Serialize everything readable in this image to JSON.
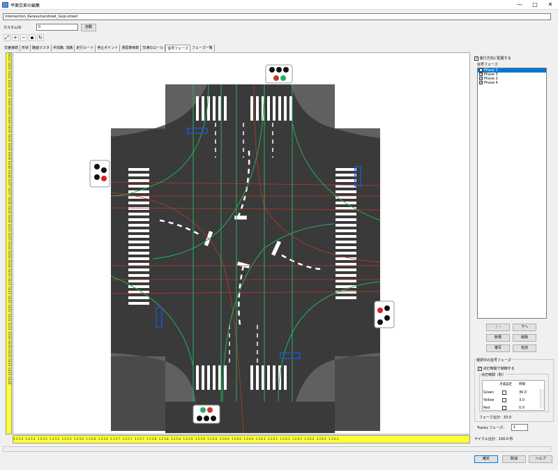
{
  "window": {
    "title": "平面交差の編集",
    "minimize": "—",
    "maximize": "□",
    "close": "✕"
  },
  "name_value": "Intersection_Karasumarstreet_Gojo-street",
  "custom_id": {
    "label": "カスタムID",
    "value": "0",
    "auto_button": "自動"
  },
  "toolbar": [
    {
      "name": "zoom-fit-icon",
      "glyph": "⤢"
    },
    {
      "name": "zoom-in-icon",
      "glyph": "+"
    },
    {
      "name": "zoom-out-icon",
      "glyph": "−"
    },
    {
      "name": "save-icon",
      "glyph": "▪"
    },
    {
      "name": "refresh-icon",
      "glyph": "↻"
    }
  ],
  "tabs": [
    "交差接続",
    "形状",
    "路面マスタ",
    "手前路, 流路",
    "走行ルート",
    "停止ポイント",
    "滞留車両数",
    "交通のロール",
    "信号フェーズ",
    "フェーズ一覧"
  ],
  "active_tab": 8,
  "ruler_v_text": "0442 0441 0441 0441 0441 0440 0440 0440 0439 0439 0439 0438 0438 0438 0437 0437 0436 0436 0436 0435 0435 0434 0434 0434 0433 0433 0432 0432 0432 0431 0431 0430 0430 0430 0429 0429 0428",
  "ruler_h_text": "1254 1254 1255 1255 1255 1256 1256 1256 1257 1257 1257 1258 1258 1258 1259 1259 1259 1260 1260 1260 1261 1261 1261 1262 1262 1262 1263",
  "right": {
    "place_check_label": "進行方向に配置する",
    "phase_list_label": "信号フェーズ",
    "phases": [
      "Phase 1",
      "Phase 3",
      "Phase 2",
      "Phase 4"
    ],
    "up": "上へ",
    "down": "下へ",
    "new": "新規",
    "delete": "削除",
    "copy": "複写",
    "rename": "名前",
    "selected_group_label": "選択中の信号フェーズ",
    "blink_check_label": "点灯時間で制御する",
    "duration_group_label": "点灯時間（秒）",
    "table_headers": [
      "",
      "点滅設定",
      "時間"
    ],
    "rows": [
      {
        "color": "Green",
        "value": "30.0"
      },
      {
        "color": "Yellow",
        "value": "3.0"
      },
      {
        "color": "Red",
        "value": "0.0"
      }
    ],
    "phase_total": "フェーズ合計：33.0",
    "tracks_label": "Tracks フェーズ：",
    "tracks_value": "1",
    "cycle_total": "サイクル合計：100.0 秒"
  },
  "bottom": {
    "ok": "確定",
    "cancel": "取消",
    "help": "ヘルプ"
  }
}
